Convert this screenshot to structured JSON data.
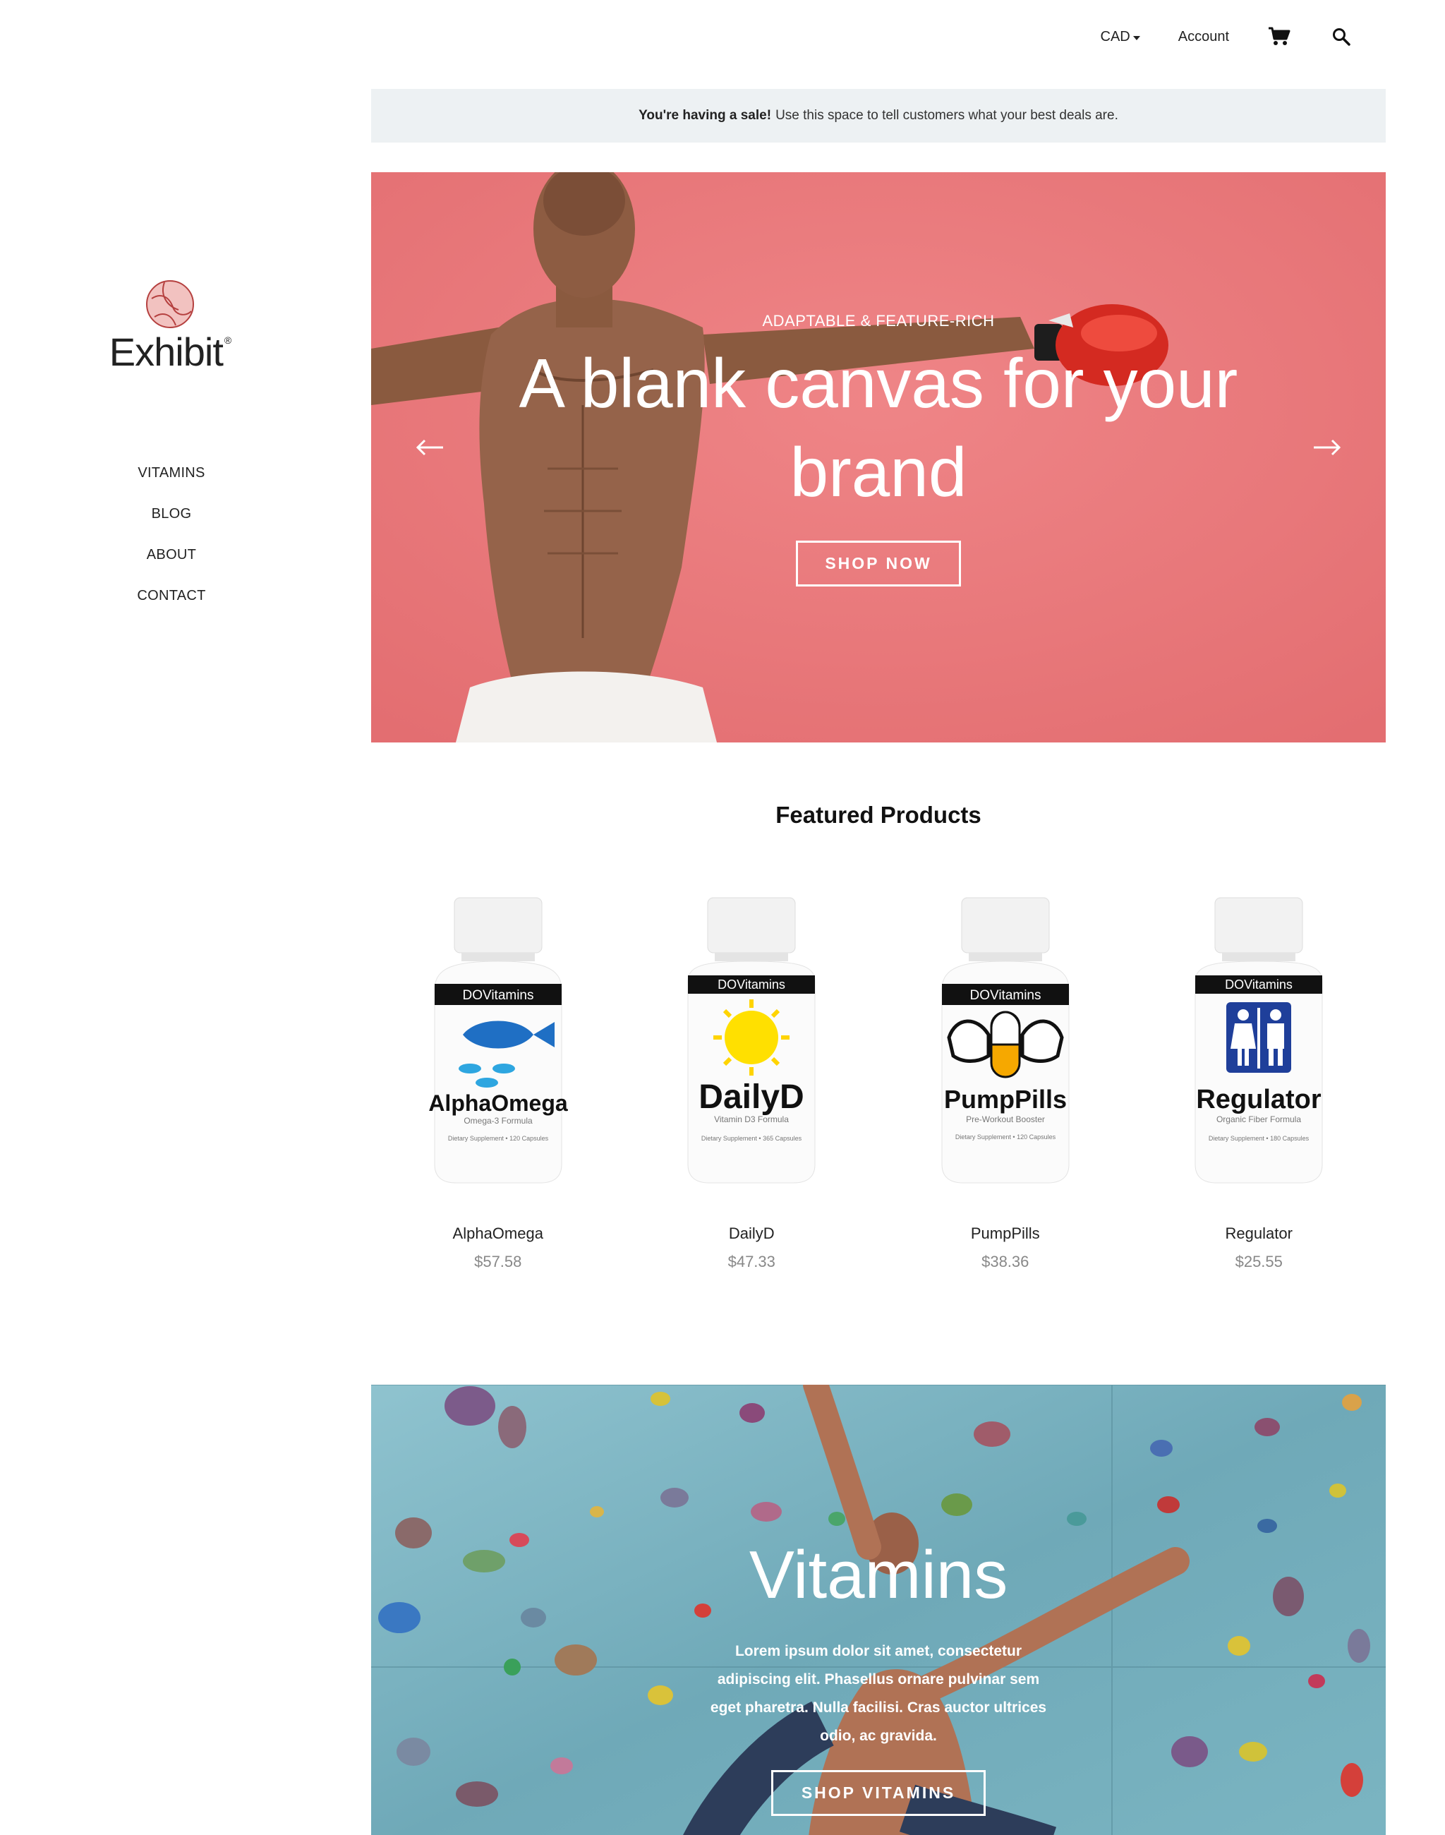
{
  "header": {
    "currency": "CAD",
    "account_label": "Account"
  },
  "sidebar": {
    "logo_text": "Exhibit",
    "logo_mark": "®",
    "nav": [
      {
        "label": "VITAMINS"
      },
      {
        "label": "BLOG"
      },
      {
        "label": "ABOUT"
      },
      {
        "label": "CONTACT"
      }
    ]
  },
  "announcement": {
    "bold": "You're having a sale!",
    "text": "Use this space to tell customers what your best deals are."
  },
  "hero": {
    "kicker": "ADAPTABLE & FEATURE-RICH",
    "title_line1": "A blank canvas for your",
    "title_line2": "brand",
    "button": "SHOP NOW",
    "bg_color": "#e9787a"
  },
  "featured": {
    "title": "Featured Products",
    "products": [
      {
        "name": "AlphaOmega",
        "price": "$57.58",
        "bottle_brand": "DOVitamins",
        "bottle_title": "AlphaOmega",
        "bottle_sub": "Omega-3 Formula",
        "bottle_note": "Dietary Supplement • 120 Capsules"
      },
      {
        "name": "DailyD",
        "price": "$47.33",
        "bottle_brand": "DOVitamins",
        "bottle_title": "DailyD",
        "bottle_sub": "Vitamin D3 Formula",
        "bottle_note": "Dietary Supplement • 365 Capsules"
      },
      {
        "name": "PumpPills",
        "price": "$38.36",
        "bottle_brand": "DOVitamins",
        "bottle_title": "PumpPills",
        "bottle_sub": "Pre-Workout Booster",
        "bottle_note": "Dietary Supplement • 120 Capsules"
      },
      {
        "name": "Regulator",
        "price": "$25.55",
        "bottle_brand": "DOVitamins",
        "bottle_title": "Regulator",
        "bottle_sub": "Organic Fiber Formula",
        "bottle_note": "Dietary Supplement • 180 Capsules"
      }
    ]
  },
  "collection": {
    "title": "Vitamins",
    "text": "Lorem ipsum dolor sit amet, consectetur adipiscing elit. Phasellus ornare pulvinar sem eget pharetra. Nulla facilisi. Cras auctor ultrices odio, ac gravida.",
    "button": "SHOP VITAMINS"
  },
  "icons": {
    "cart": "cart-icon",
    "search": "search-icon",
    "prev": "arrow-left-icon",
    "next": "arrow-right-icon"
  }
}
